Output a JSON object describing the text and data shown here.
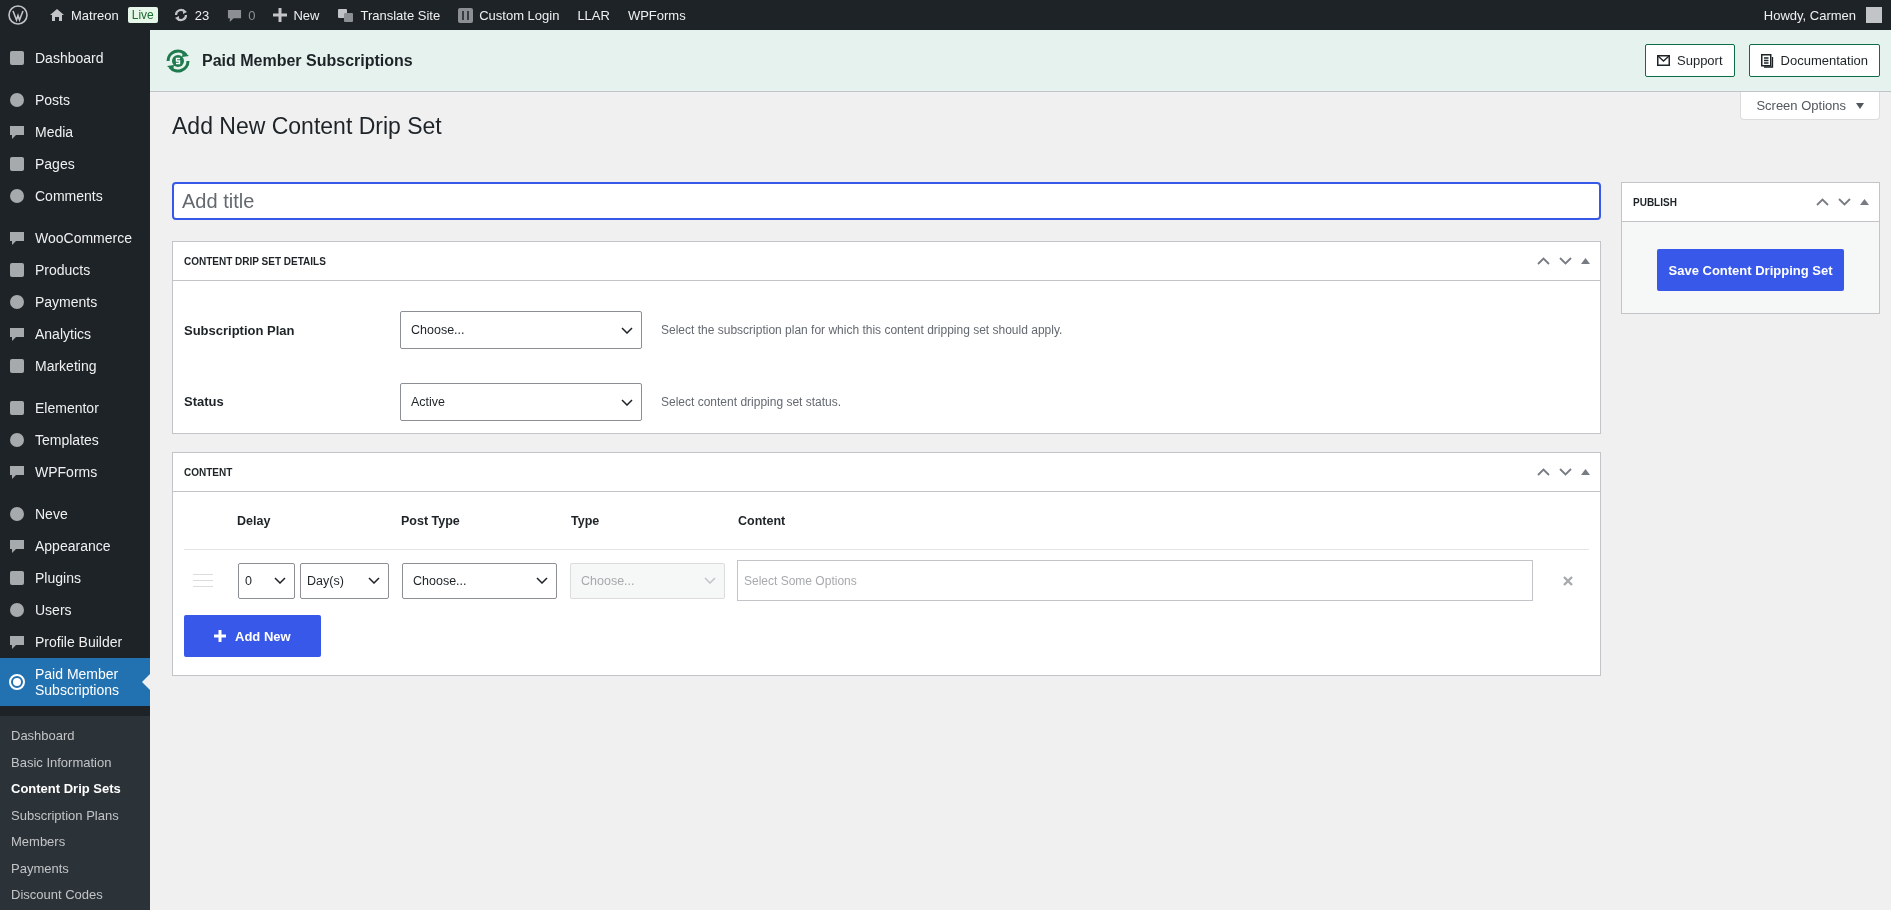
{
  "admin_bar": {
    "site": "Matreon",
    "badge": "Live",
    "updates": "23",
    "comments": "0",
    "new": "New",
    "links": [
      "Translate Site",
      "Custom Login",
      "LLAR",
      "WPForms"
    ],
    "account": "Howdy, Carmen"
  },
  "sidebar": {
    "groups": [
      [
        {
          "label": "Dashboard",
          "selected": false
        }
      ],
      [
        {
          "label": "Posts",
          "selected": false
        },
        {
          "label": "Media",
          "selected": false
        },
        {
          "label": "Pages",
          "selected": false
        },
        {
          "label": "Comments",
          "selected": false
        }
      ],
      [
        {
          "label": "WooCommerce",
          "selected": false
        },
        {
          "label": "Products",
          "selected": false
        },
        {
          "label": "Payments",
          "selected": false
        },
        {
          "label": "Analytics",
          "selected": false
        },
        {
          "label": "Marketing",
          "selected": false
        }
      ],
      [
        {
          "label": "Elementor",
          "selected": false
        },
        {
          "label": "Templates",
          "selected": false
        },
        {
          "label": "WPForms",
          "selected": false
        }
      ],
      [
        {
          "label": "Neve",
          "selected": false
        },
        {
          "label": "Appearance",
          "selected": false
        },
        {
          "label": "Plugins",
          "selected": false
        },
        {
          "label": "Users",
          "selected": false
        },
        {
          "label": "Profile Builder",
          "selected": false
        },
        {
          "label": "Paid Member Subscriptions",
          "selected": true
        }
      ]
    ],
    "submenu": [
      {
        "label": "Dashboard",
        "selected": false
      },
      {
        "label": "Basic Information",
        "selected": false
      },
      {
        "label": "Content Drip Sets",
        "selected": true
      },
      {
        "label": "Subscription Plans",
        "selected": false
      },
      {
        "label": "Members",
        "selected": false
      },
      {
        "label": "Payments",
        "selected": false
      },
      {
        "label": "Discount Codes",
        "selected": false
      }
    ]
  },
  "plugin_header": {
    "title": "Paid Member Subscriptions",
    "buttons": [
      "Support",
      "Documentation"
    ]
  },
  "screen_options": "Screen Options",
  "page_title": "Add New Content Drip Set",
  "title_field": {
    "placeholder": "Add title"
  },
  "details_box": {
    "title": "CONTENT DRIP SET DETAILS",
    "fields": [
      {
        "label": "Subscription Plan",
        "value": "Choose...",
        "help": "Select the subscription plan for which this content dripping set should apply."
      },
      {
        "label": "Status",
        "value": "Active",
        "help": "Select content dripping set status."
      }
    ]
  },
  "content_box": {
    "title": "CONTENT",
    "columns": [
      "Delay",
      "Post Type",
      "Type",
      "Content"
    ],
    "rows": [
      {
        "delay": "0",
        "unit": "Day(s)",
        "post_type": "Choose...",
        "type": {
          "value": "Choose...",
          "disabled": true
        },
        "content_placeholder": "Select Some Options"
      }
    ],
    "add_button": "Add New"
  },
  "publish_box": {
    "title": "PUBLISH",
    "button": "Save Content Dripping Set"
  }
}
